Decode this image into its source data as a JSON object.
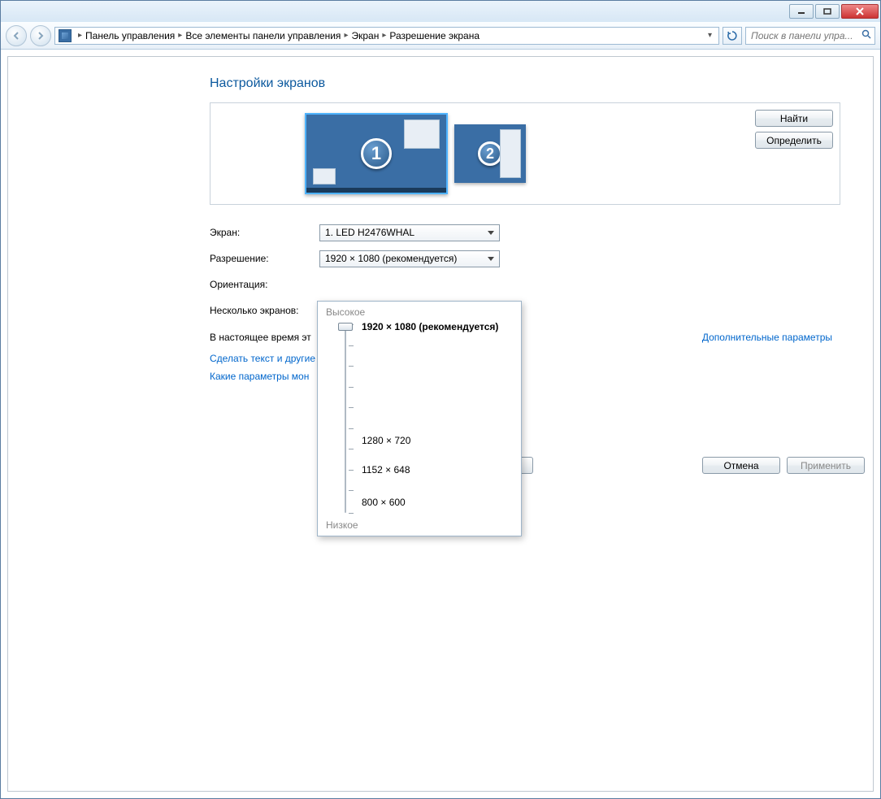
{
  "breadcrumb": {
    "items": [
      "Панель управления",
      "Все элементы панели управления",
      "Экран",
      "Разрешение экрана"
    ]
  },
  "search": {
    "placeholder": "Поиск в панели упра..."
  },
  "page_title": "Настройки экранов",
  "side_buttons": {
    "find": "Найти",
    "identify": "Определить"
  },
  "monitor1_number": "1",
  "monitor2_number": "2",
  "labels": {
    "screen": "Экран:",
    "resolution": "Разрешение:",
    "orientation": "Ориентация:",
    "multi": "Несколько экранов:"
  },
  "screen_combo": "1. LED H2476WHAL",
  "resolution_combo": "1920 × 1080 (рекомендуется)",
  "info_line_prefix": "В настоящее время эт",
  "adv_link": "Дополнительные параметры",
  "link_text1": "Сделать текст и другие",
  "link_text2": "Какие параметры мон",
  "slider": {
    "top_label": "Высокое",
    "bottom_label": "Низкое",
    "current": "1920 × 1080 (рекомендуется)",
    "mid1": "1280 × 720",
    "mid2": "1152 × 648",
    "low": "800 × 600"
  },
  "bottom": {
    "cancel": "Отмена",
    "apply": "Применить"
  }
}
